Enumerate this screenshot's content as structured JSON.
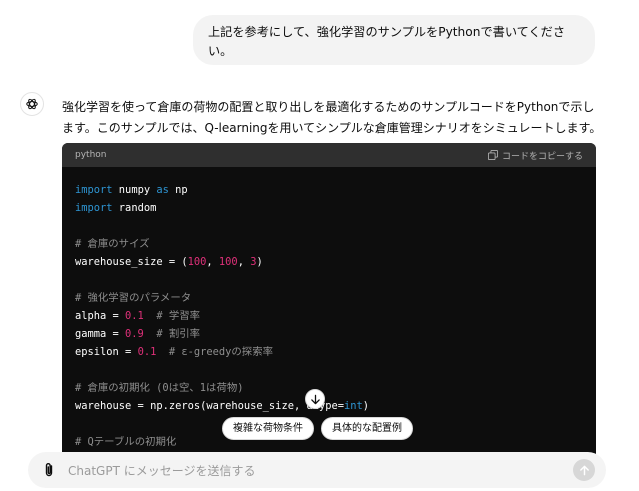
{
  "user_message": "上記を参考にして、強化学習のサンプルをPythonで書いてください。",
  "assistant": {
    "avatar_icon": "openai-logo-icon",
    "intro": "強化学習を使って倉庫の荷物の配置と取り出しを最適化するためのサンプルコードをPythonで示します。このサンプルでは、Q-learningを用いてシンプルな倉庫管理シナリオをシミュレートします。"
  },
  "code_block": {
    "language": "python",
    "copy_label": "コードをコピーする",
    "copy_icon": "copy-icon",
    "lines": [
      [
        {
          "t": "import",
          "c": "kw"
        },
        {
          "t": " numpy ",
          "c": "tx"
        },
        {
          "t": "as",
          "c": "kw"
        },
        {
          "t": " np",
          "c": "tx"
        }
      ],
      [
        {
          "t": "import",
          "c": "kw"
        },
        {
          "t": " random",
          "c": "tx"
        }
      ],
      [],
      [
        {
          "t": "# 倉庫のサイズ",
          "c": "cm"
        }
      ],
      [
        {
          "t": "warehouse_size = (",
          "c": "tx"
        },
        {
          "t": "100",
          "c": "num"
        },
        {
          "t": ", ",
          "c": "tx"
        },
        {
          "t": "100",
          "c": "num"
        },
        {
          "t": ", ",
          "c": "tx"
        },
        {
          "t": "3",
          "c": "num"
        },
        {
          "t": ")",
          "c": "tx"
        }
      ],
      [],
      [
        {
          "t": "# 強化学習のパラメータ",
          "c": "cm"
        }
      ],
      [
        {
          "t": "alpha = ",
          "c": "tx"
        },
        {
          "t": "0.1",
          "c": "num"
        },
        {
          "t": "  # 学習率",
          "c": "cm"
        }
      ],
      [
        {
          "t": "gamma = ",
          "c": "tx"
        },
        {
          "t": "0.9",
          "c": "num"
        },
        {
          "t": "  # 割引率",
          "c": "cm"
        }
      ],
      [
        {
          "t": "epsilon = ",
          "c": "tx"
        },
        {
          "t": "0.1",
          "c": "num"
        },
        {
          "t": "  # ε-greedyの探索率",
          "c": "cm"
        }
      ],
      [],
      [
        {
          "t": "# 倉庫の初期化 (0は空、1は荷物)",
          "c": "cm"
        }
      ],
      [
        {
          "t": "warehouse = np.zeros(warehouse_size, dtype=",
          "c": "tx"
        },
        {
          "t": "int",
          "c": "kw"
        },
        {
          "t": ")",
          "c": "tx"
        }
      ],
      [],
      [
        {
          "t": "# Qテーブルの初期化",
          "c": "cm"
        }
      ]
    ]
  },
  "scroll_button_icon": "arrow-down-icon",
  "suggestions": [
    "複雑な荷物条件",
    "具体的な配置例"
  ],
  "composer": {
    "placeholder": "ChatGPT にメッセージを送信する",
    "attach_icon": "paperclip-icon",
    "send_icon": "arrow-up-icon"
  }
}
